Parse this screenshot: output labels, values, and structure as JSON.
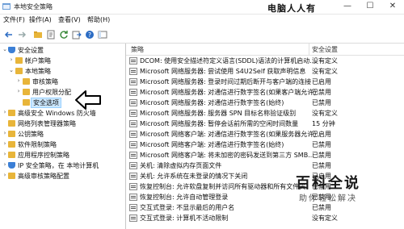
{
  "window": {
    "title": "本地安全策略",
    "watermark_top": "电脑人人有",
    "minimize": "—",
    "maximize": "☐",
    "close": "✕"
  },
  "menubar": {
    "items": [
      "文件(F)",
      "操作(A)",
      "查看(V)",
      "帮助(H)"
    ]
  },
  "toolbar": {
    "icons": [
      "back-icon",
      "forward-icon",
      "up-folder-icon",
      "properties-icon",
      "refresh-icon",
      "export-icon",
      "help-icon",
      "console-icon"
    ]
  },
  "tree": {
    "items": [
      {
        "label": "安全设置",
        "exp": "⌄",
        "depth": 0
      },
      {
        "label": "帐户策略",
        "exp": "›",
        "depth": 1
      },
      {
        "label": "本地策略",
        "exp": "⌄",
        "depth": 1
      },
      {
        "label": "审核策略",
        "exp": "›",
        "depth": 2
      },
      {
        "label": "用户权限分配",
        "exp": "›",
        "depth": 2
      },
      {
        "label": "安全选项",
        "exp": "",
        "depth": 2
      },
      {
        "label": "高级安全 Windows 防火墙",
        "exp": "›",
        "depth": 1
      },
      {
        "label": "网络列表管理器策略",
        "exp": "",
        "depth": 1
      },
      {
        "label": "公钥策略",
        "exp": "›",
        "depth": 1
      },
      {
        "label": "软件限制策略",
        "exp": "›",
        "depth": 1
      },
      {
        "label": "应用程序控制策略",
        "exp": "›",
        "depth": 1
      },
      {
        "label": "IP 安全策略，在 本地计算机",
        "exp": "›",
        "depth": 1
      },
      {
        "label": "高级审核策略配置",
        "exp": "›",
        "depth": 1
      }
    ]
  },
  "list": {
    "col_policy": "策略",
    "col_setting": "安全设置",
    "rows": [
      {
        "policy": "DCOM: 使用安全描述符定义语言(SDDL)语法的计算机启动...",
        "setting": "没有定义"
      },
      {
        "policy": "Microsoft 网络服务器: 尝试使用 S4U2Self 获取声明信息",
        "setting": "没有定义"
      },
      {
        "policy": "Microsoft 网络服务器: 登录时间过期后断开与客户端的连接",
        "setting": "已启用"
      },
      {
        "policy": "Microsoft 网络服务器: 对通信进行数字签名(如果客户端允许)",
        "setting": "已禁用"
      },
      {
        "policy": "Microsoft 网络服务器: 对通信进行数字签名(始终)",
        "setting": "已禁用"
      },
      {
        "policy": "Microsoft 网络服务器: 服务器 SPN 目标名称验证级别",
        "setting": "没有定义"
      },
      {
        "policy": "Microsoft 网络服务器: 暂停会话前所需的空闲时间数量",
        "setting": "15 分钟"
      },
      {
        "policy": "Microsoft 网络客户端: 对通信进行数字签名(如果服务器允许)",
        "setting": "已启用"
      },
      {
        "policy": "Microsoft 网络客户端: 对通信进行数字签名(始终)",
        "setting": "已禁用"
      },
      {
        "policy": "Microsoft 网络客户端: 将未加密的密码发送到第三方 SMB...",
        "setting": "已禁用"
      },
      {
        "policy": "关机: 清除虚拟内存页面文件",
        "setting": "已禁用"
      },
      {
        "policy": "关机: 允许系统在未登录的情况下关闭",
        "setting": "已启用"
      },
      {
        "policy": "恢复控制台: 允许软盘复制并访问所有驱动器和所有文件夹",
        "setting": "已禁用"
      },
      {
        "policy": "恢复控制台: 允许自动管理登录",
        "setting": "已禁用"
      },
      {
        "policy": "交互式登录: 不显示最后的用户名",
        "setting": "已禁用"
      },
      {
        "policy": "交互式登录: 计算机不活动限制",
        "setting": "没有定义"
      }
    ]
  },
  "brand": {
    "big": "百科全说",
    "small": "助你轻松解决"
  }
}
